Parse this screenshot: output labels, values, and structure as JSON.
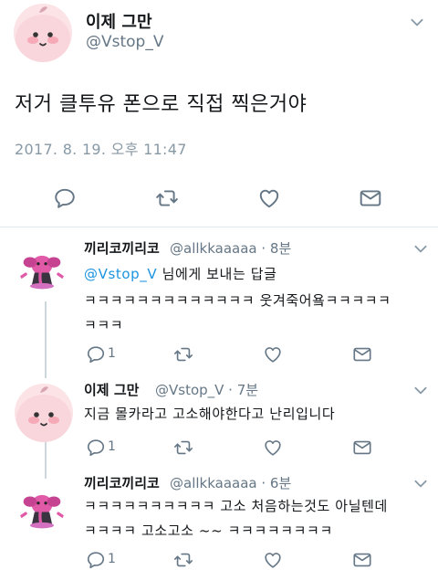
{
  "main_tweet": {
    "name": "이제 그만",
    "handle": "@Vstop_V",
    "text": "저거 클투유 폰으로 직접 찍은거야",
    "time": "2017. 8. 19. 오후 11:47"
  },
  "replies": [
    {
      "name": "끼리코끼리코",
      "handle_meta": "@allkkaaaaa · 8분",
      "mention": "@Vstop_V",
      "mention_suffix": " 님에게 보내는 답글",
      "lines": [
        "ㅋㅋㅋㅋㅋㅋㅋㅋㅋㅋㅋㅋㅋ 웃겨죽어욬ㅋㅋㅋㅋㅋ",
        "ㅋㅋㅋ"
      ],
      "reply_count": "1"
    },
    {
      "name": "이제 그만",
      "handle_meta": "@Vstop_V · 7분",
      "lines": [
        "지금 몰카라고 고소해야한다고 난리입니다"
      ],
      "reply_count": "1"
    },
    {
      "name": "끼리코끼리코",
      "handle_meta": "@allkkaaaaa · 6분",
      "lines": [
        "ㅋㅋㅋㅋㅋㅋㅋㅋㅋㅋ 고소 처음하는것도 아닐텐데",
        "ㅋㅋㅋㅋ 고소고소 ~~ ㅋㅋㅋㅋㅋㅋㅋㅋ"
      ],
      "reply_count": "1"
    }
  ],
  "colors": {
    "link": "#1b95e0",
    "icon_gray": "#657786",
    "separator": "#e1e8ed"
  },
  "icons": [
    "caret-down-icon",
    "reply-icon",
    "retweet-icon",
    "like-icon",
    "dm-icon"
  ]
}
